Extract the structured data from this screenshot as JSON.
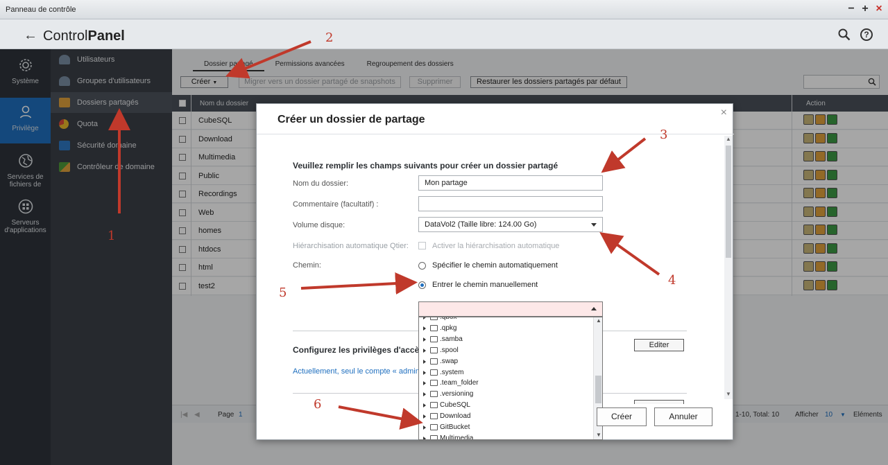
{
  "window": {
    "title": "Panneau de contrôle",
    "minimize": "−",
    "maximize": "+",
    "close": "×"
  },
  "header": {
    "back": "←",
    "title_light": "Control",
    "title_bold": "Panel",
    "help": "?"
  },
  "rail": [
    {
      "label": "Système",
      "icon": "gear-icon"
    },
    {
      "label": "Privilège",
      "icon": "user-icon",
      "active": true
    },
    {
      "label": "Services de fichiers de",
      "icon": "globe-icon"
    },
    {
      "label": "Serveurs d'applications",
      "icon": "apps-grid-icon"
    }
  ],
  "menu": [
    {
      "label": "Utilisateurs",
      "color": "#7a8ea3"
    },
    {
      "label": "Groupes d'utilisateurs",
      "color": "#7a8ea3"
    },
    {
      "label": "Dossiers partagés",
      "color": "#e0a23c",
      "active": true
    },
    {
      "label": "Quota",
      "color": "#e8b92a"
    },
    {
      "label": "Sécurité domaine",
      "color": "#2f78c4"
    },
    {
      "label": "Contrôleur de domaine",
      "color": "#4f9a3a"
    }
  ],
  "tabs": [
    "Dossier partagé",
    "Permissions avancées",
    "Regroupement des dossiers"
  ],
  "toolbar": {
    "create": "Créer",
    "migrate": "Migrer vers un dossier partagé de snapshots",
    "delete": "Supprimer",
    "restore": "Restaurer les dossiers partagés par défaut"
  },
  "table": {
    "col_name": "Nom du dossier",
    "col_action": "Action",
    "rows": [
      "CubeSQL",
      "Download",
      "Multimedia",
      "Public",
      "Recordings",
      "Web",
      "homes",
      "htdocs",
      "html",
      "test2"
    ]
  },
  "pager": {
    "page_label": "Page",
    "page": "1",
    "summary": "1-10, Total: 10",
    "show_label": "Afficher",
    "show_value": "10",
    "elements": "Eléments"
  },
  "modal": {
    "title": "Créer un dossier de partage",
    "close": "×",
    "intro": "Veuillez remplir les champs suivants pour créer un dossier partagé",
    "name_label": "Nom du dossier:",
    "name_value": "Mon partage",
    "comment_label": "Commentaire (facultatif) :",
    "comment_value": "",
    "volume_label": "Volume disque:",
    "volume_value": "DataVol2 (Taille libre: 124.00 Go)",
    "qtier_label": "Hiérarchisation automatique Qtier:",
    "qtier_option": "Activer la hiérarchisation automatique",
    "path_label": "Chemin:",
    "path_auto": "Spécifier le chemin automatiquement",
    "path_manual": "Entrer le chemin manuellement",
    "priv_title": "Configurez les privilèges d'accès",
    "priv_note": "Actuellement, seul le compte « admin",
    "edit": "Editer",
    "create": "Créer",
    "cancel": "Annuler"
  },
  "tree": [
    ".qbox",
    ".qpkg",
    ".samba",
    ".spool",
    ".swap",
    ".system",
    ".team_folder",
    ".versioning",
    "CubeSQL",
    "Download",
    "GitBucket",
    "Multimedia"
  ],
  "annotations": [
    "1",
    "2",
    "3",
    "4",
    "5",
    "6"
  ],
  "colors": {
    "annotation": "#c0392b",
    "accent": "#1f6fbf"
  }
}
